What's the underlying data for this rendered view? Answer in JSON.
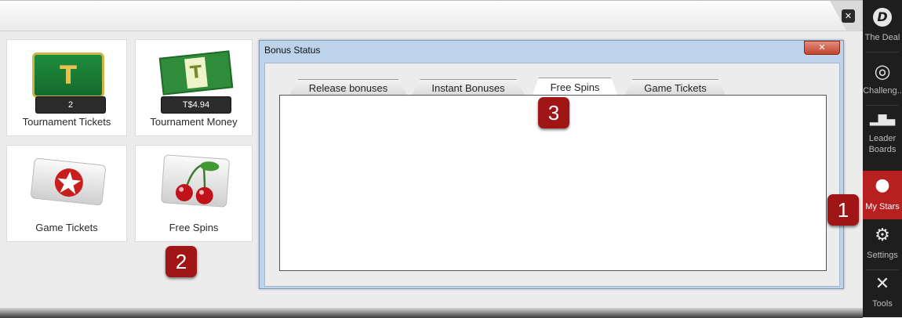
{
  "window": {
    "close_glyph": "✕"
  },
  "cards": [
    {
      "label": "Tournament Tickets",
      "pill": "2"
    },
    {
      "label": "Tournament Money",
      "pill": "T$4.94"
    },
    {
      "label": "Game Tickets"
    },
    {
      "label": "Free Spins"
    }
  ],
  "dialog": {
    "title": "Bonus Status",
    "close_glyph": "✕",
    "tabs": [
      "Release bonuses",
      "Instant Bonuses",
      "Free Spins",
      "Game Tickets"
    ],
    "active_tab": "Free Spins"
  },
  "badges": [
    "1",
    "2",
    "3"
  ],
  "rail": [
    {
      "label": "The Deal",
      "icon": "the-deal-icon"
    },
    {
      "label": "Challeng..",
      "icon": "dartboard-icon"
    },
    {
      "label": "Leader Boards",
      "icon": "podium-icon"
    },
    {
      "label": "My Stars",
      "icon": "profile-icon"
    },
    {
      "label": "Settings",
      "icon": "gear-icon"
    },
    {
      "label": "Tools",
      "icon": "tools-icon"
    }
  ],
  "colors": {
    "accent": "#b81f1f",
    "badge": "#a01616",
    "rail": "#1e1e1e"
  }
}
